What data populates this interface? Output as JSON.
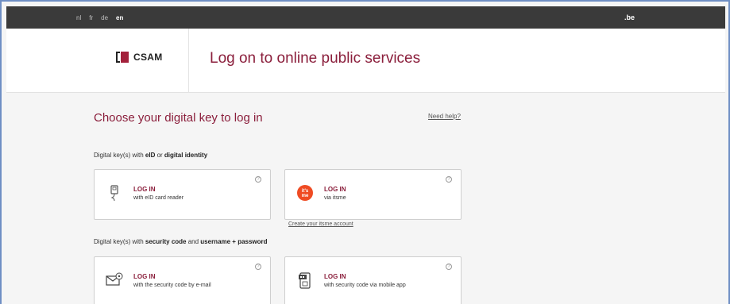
{
  "topbar": {
    "languages": [
      {
        "code": "nl",
        "active": false
      },
      {
        "code": "fr",
        "active": false
      },
      {
        "code": "de",
        "active": false
      },
      {
        "code": "en",
        "active": true
      }
    ],
    "domain": ".be"
  },
  "header": {
    "logo_text": "CSAM",
    "title": "Log on to online public services"
  },
  "main": {
    "choose_title": "Choose your digital key to log in",
    "help_link": "Need help?",
    "section1": {
      "prefix": "Digital key(s) with ",
      "b1": "eID",
      "mid": " or ",
      "b2": "digital identity"
    },
    "section2": {
      "prefix": "Digital key(s) with ",
      "b1": "security code",
      "mid": " and ",
      "b2": "username + password"
    },
    "cards": [
      {
        "title": "LOG IN",
        "subtitle": "with eID card reader",
        "icon": "card-reader-icon"
      },
      {
        "title": "LOG IN",
        "subtitle": "via itsme",
        "icon": "itsme-icon"
      },
      {
        "title": "LOG IN",
        "subtitle": "with the security code by e-mail",
        "icon": "email-code-icon"
      },
      {
        "title": "LOG IN",
        "subtitle": "with security code via mobile app",
        "icon": "mobile-app-icon"
      }
    ],
    "create_itsme": "Create your itsme account",
    "help_symbol": "?"
  },
  "colors": {
    "brand": "#8b1f3c",
    "topbar": "#3a3a3a",
    "itsme": "#ef4b23"
  }
}
